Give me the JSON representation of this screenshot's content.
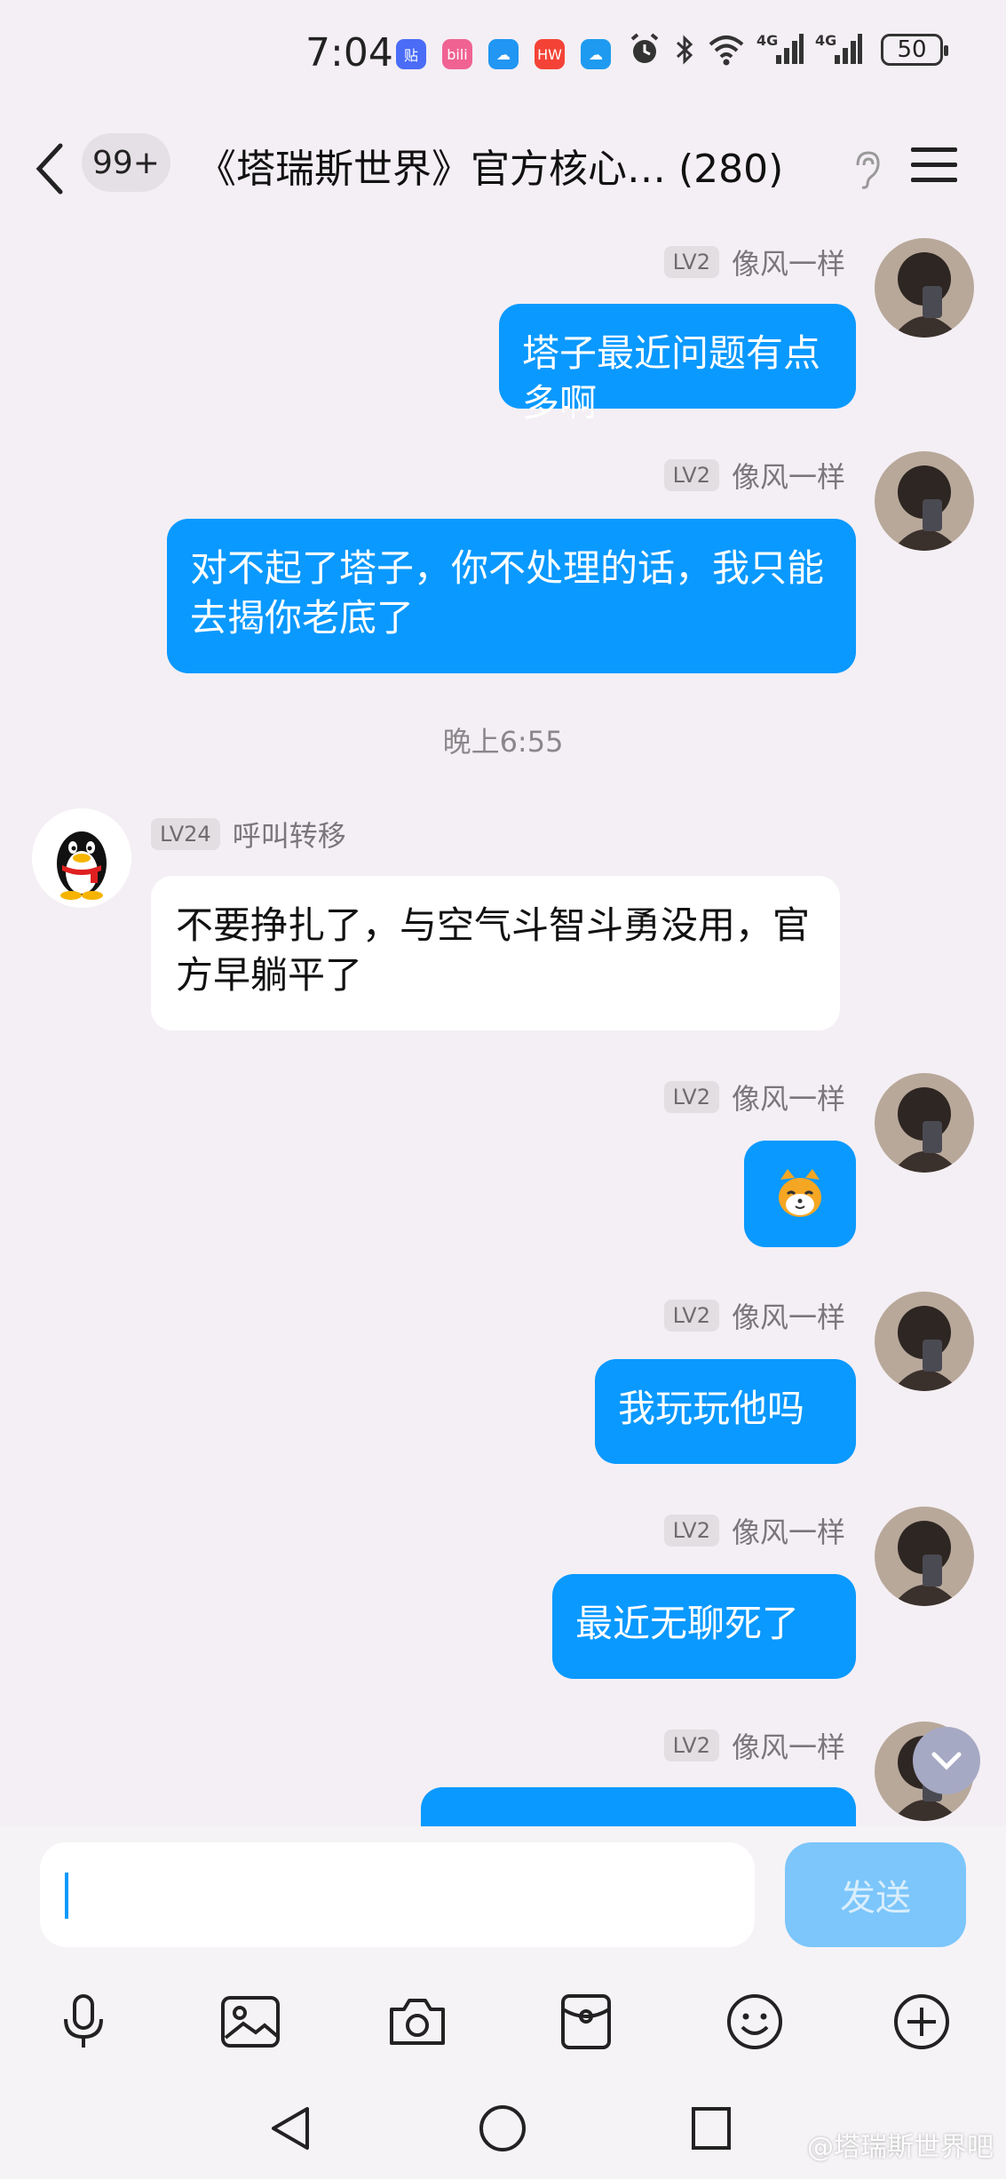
{
  "status_bar": {
    "time": "7:04",
    "app_icons": [
      {
        "name": "tieba-icon",
        "label": "贴",
        "color": "#4a6cf7"
      },
      {
        "name": "bilibili-icon",
        "label": "bili",
        "color": "#f06292"
      },
      {
        "name": "weather-icon",
        "label": "☁",
        "color": "#2196f3"
      },
      {
        "name": "huawei-store-icon",
        "label": "HW",
        "color": "#f44336"
      },
      {
        "name": "cloud-icon",
        "label": "☁",
        "color": "#1e9bf0"
      }
    ],
    "network_1": "4G",
    "network_2": "4G",
    "battery": "50"
  },
  "header": {
    "unread_count": "99+",
    "title": "《塔瑞斯世界》官方核心…",
    "member_count": "(280)"
  },
  "messages": [
    {
      "side": "right",
      "level": "LV2",
      "nickname": "像风一样",
      "text": "塔子最近问题有点多啊"
    },
    {
      "side": "right",
      "level": "LV2",
      "nickname": "像风一样",
      "text": "对不起了塔子，你不处理的话，我只能去揭你老底了"
    },
    {
      "side": "left",
      "level": "LV24",
      "nickname": "呼叫转移",
      "text": "不要挣扎了，与空气斗智斗勇没用，官方早躺平了"
    },
    {
      "side": "right",
      "level": "LV2",
      "nickname": "像风一样",
      "text": ""
    },
    {
      "side": "right",
      "level": "LV2",
      "nickname": "像风一样",
      "text": "我玩玩他吗"
    },
    {
      "side": "right",
      "level": "LV2",
      "nickname": "像风一样",
      "text": "最近无聊死了"
    },
    {
      "side": "right",
      "level": "LV2",
      "nickname": "像风一样",
      "text": ""
    }
  ],
  "timestamp": "晚上6:55",
  "composer": {
    "send_label": "发送"
  },
  "watermark": "@塔瑞斯世界吧",
  "colors": {
    "bubble_self": "#0a99ff",
    "bubble_other": "#ffffff",
    "background": "#f4eff4",
    "send_disabled": "#7cc6fb"
  }
}
